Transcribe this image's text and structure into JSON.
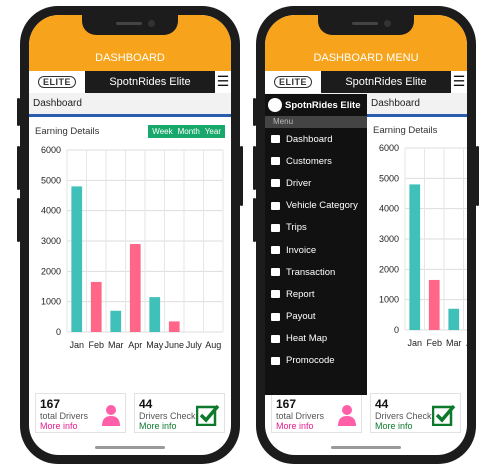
{
  "left": {
    "title": "DASHBOARD",
    "logo": "ELITE",
    "brand": "SpotnRides Elite",
    "menu_icon": "☰",
    "breadcrumb": "Dashboard",
    "card_title": "Earning Details",
    "range_tabs": [
      "Week",
      "Month",
      "Year"
    ],
    "stats": [
      {
        "number": "167",
        "label": "total Drivers",
        "more": "More info"
      },
      {
        "number": "44",
        "label": "Drivers Check",
        "more": "More info"
      }
    ]
  },
  "right": {
    "title": "DASHBOARD MENU",
    "logo": "ELITE",
    "brand": "SpotnRides Elite",
    "menu_icon": "☰",
    "breadcrumb": "Dashboard",
    "card_title": "Earning Details",
    "side_brand": "SpotnRides Elite",
    "side_menu_title": "Menu",
    "side_menu": [
      "Dashboard",
      "Customers",
      "Driver",
      "Vehicle Category",
      "Trips",
      "Invoice",
      "Transaction",
      "Report",
      "Payout",
      "Heat Map",
      "Promocode"
    ],
    "stats": [
      {
        "number": "167",
        "label": "total Drivers",
        "more": "More info"
      },
      {
        "number": "44",
        "label": "Drivers Check",
        "more": "More info"
      }
    ]
  },
  "colors": {
    "accent": "#f7a41c",
    "teal": "#3fc0b8",
    "pink": "#ff6688",
    "green": "#17a86b"
  },
  "chart_data": {
    "type": "bar",
    "categories": [
      "Jan",
      "Feb",
      "Mar",
      "Apr",
      "May",
      "June",
      "July",
      "Aug"
    ],
    "series": [
      {
        "values": [
          4800,
          0,
          700,
          0,
          1150,
          0,
          0,
          0
        ]
      },
      {
        "values": [
          0,
          1650,
          0,
          2900,
          0,
          350,
          0,
          0
        ]
      }
    ],
    "ylim": [
      0,
      6000
    ],
    "yticks": [
      0,
      1000,
      2000,
      3000,
      4000,
      5000,
      6000
    ]
  }
}
